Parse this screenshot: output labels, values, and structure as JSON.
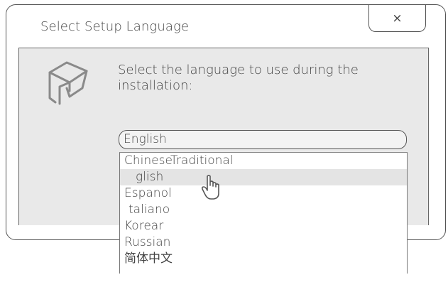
{
  "dialog": {
    "title": "Select Setup Language",
    "close_glyph": "×",
    "prompt": "Select the language to use during the installation:",
    "selected_language": "English",
    "options": [
      "ChineseTraditional",
      "glish",
      "Espanol",
      "taliano",
      "Korear",
      "Russian",
      "简体中文"
    ],
    "hovered_option_index": 1,
    "logo_icon": "box-logo-icon",
    "pointer_icon": "hand-pointer-icon"
  },
  "colors": {
    "panel_bg": "#e9e9e9",
    "border": "#555555",
    "text": "#444444",
    "hover_bg": "#e4e4e4"
  }
}
